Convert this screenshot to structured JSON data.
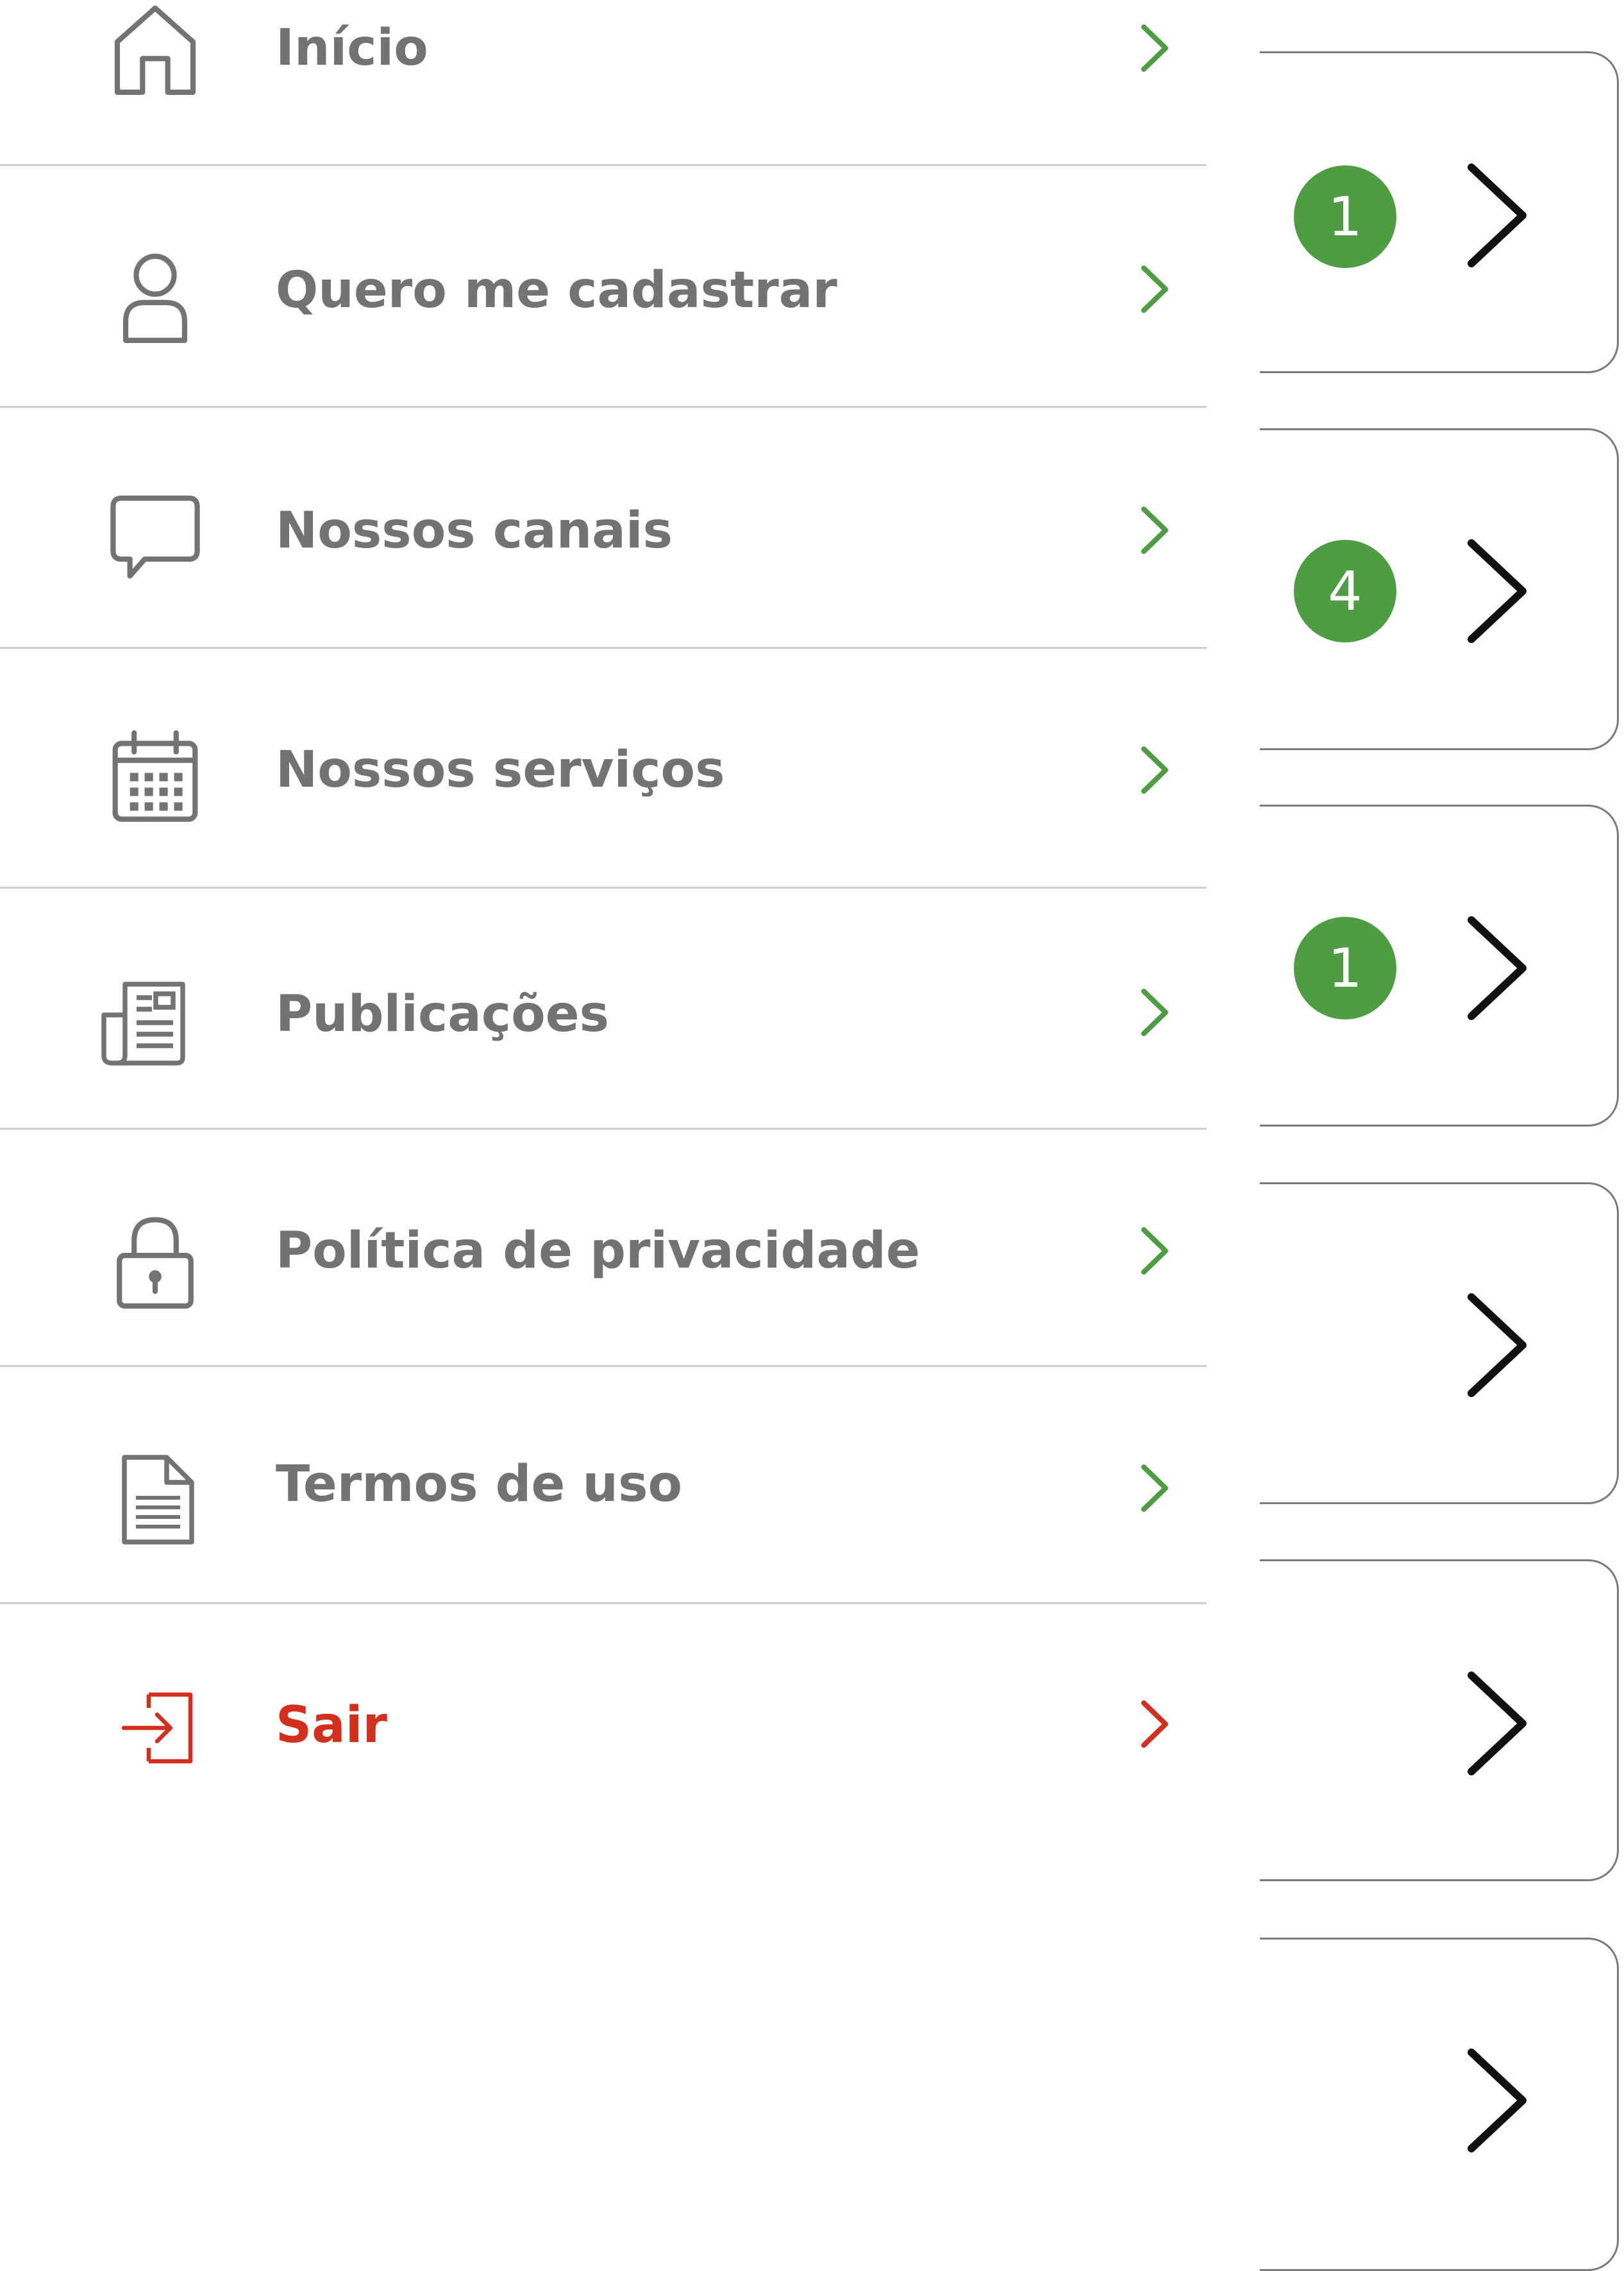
{
  "colors": {
    "label_text": "#737373",
    "danger_text": "#d22f1d",
    "accent_green": "#4f9d43",
    "divider": "#cfcfcf",
    "icon_stroke": "#737373",
    "card_border": "#7a7a7a"
  },
  "menu": {
    "items": [
      {
        "label": "Início",
        "icon": "home-icon",
        "tone": "default"
      },
      {
        "label": "Quero me cadastrar",
        "icon": "user-icon",
        "tone": "default"
      },
      {
        "label": "Nossos canais",
        "icon": "chat-bubble-icon",
        "tone": "default"
      },
      {
        "label": "Nossos serviços",
        "icon": "calendar-icon",
        "tone": "default"
      },
      {
        "label": "Publicações",
        "icon": "newspaper-icon",
        "tone": "default"
      },
      {
        "label": "Política de privacidade",
        "icon": "lock-icon",
        "tone": "default"
      },
      {
        "label": "Termos de uso",
        "icon": "document-icon",
        "tone": "default"
      },
      {
        "label": "Sair",
        "icon": "logout-icon",
        "tone": "danger"
      }
    ]
  },
  "background_cards": [
    {
      "badge": "1"
    },
    {
      "badge": "4"
    },
    {
      "badge": "1"
    },
    {
      "badge": ""
    },
    {
      "badge": ""
    },
    {
      "badge": ""
    }
  ]
}
